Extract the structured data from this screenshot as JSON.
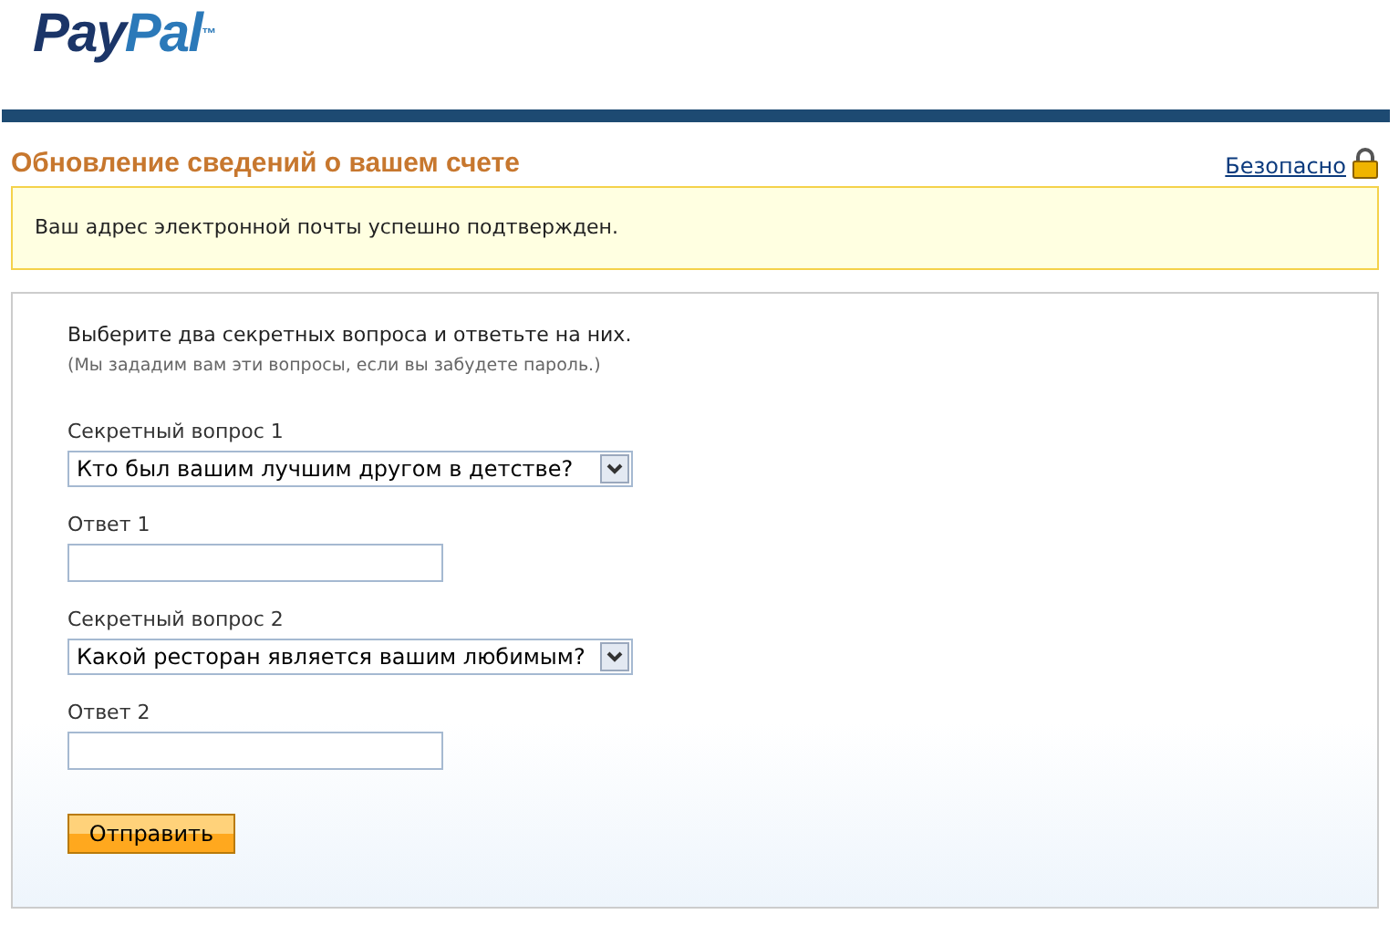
{
  "logo": [
    "Pay",
    "Pal",
    "™"
  ],
  "page_title": "Обновление сведений о вашем счете",
  "secure_link": "Безопасно",
  "notice": "Ваш адрес электронной почты успешно подтвержден.",
  "form": {
    "intro": "Выберите два секретных вопроса и ответьте на них.",
    "hint": "(Мы зададим вам эти вопросы, если вы забудете пароль.)",
    "fields": [
      {
        "kind": "select",
        "label": "Секретный вопрос 1",
        "value": "Кто был вашим лучшим другом в детстве?"
      },
      {
        "kind": "input",
        "label": "Ответ 1"
      },
      {
        "kind": "select",
        "label": "Секретный вопрос 2",
        "value": "Какой ресторан является вашим любимым?"
      },
      {
        "kind": "input",
        "label": "Ответ 2"
      }
    ],
    "submit": "Отправить"
  }
}
